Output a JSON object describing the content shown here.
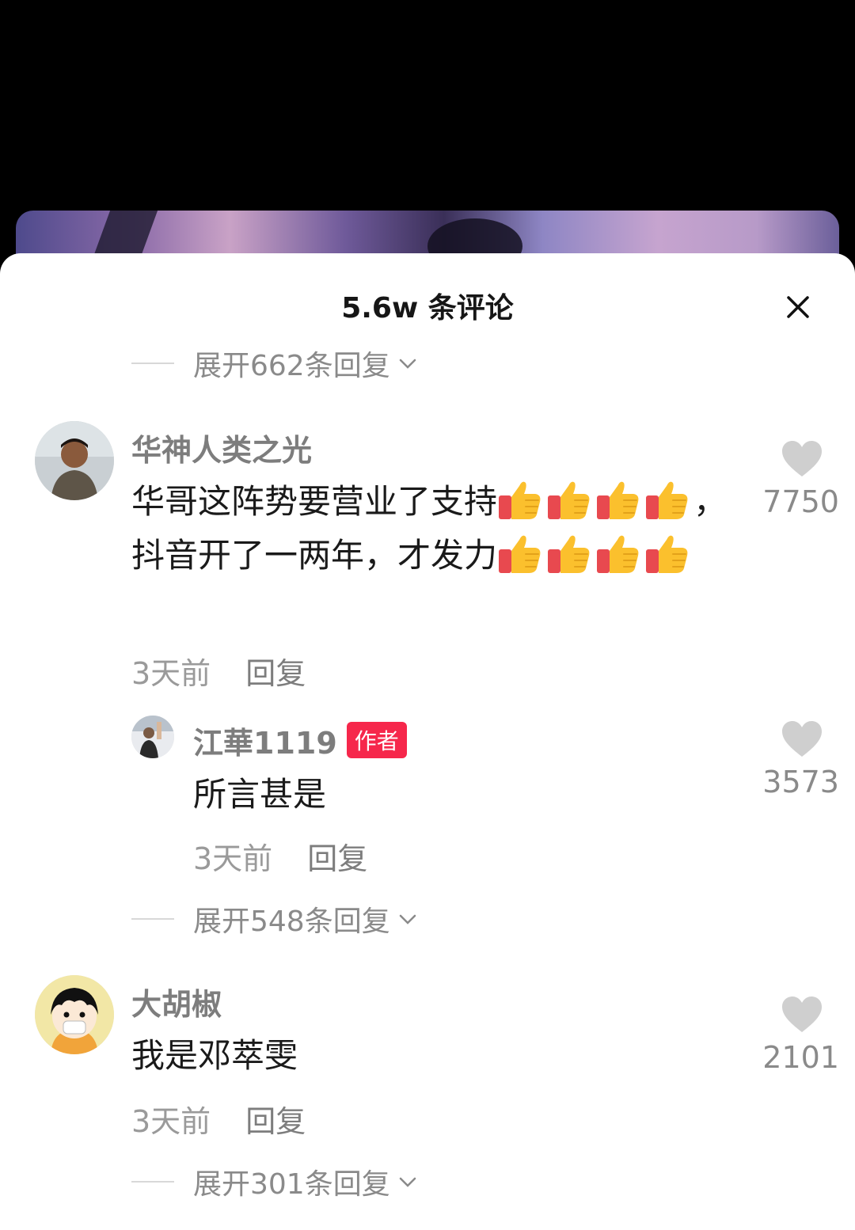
{
  "header": {
    "title": "5.6w 条评论"
  },
  "icons": {
    "close": "close-icon",
    "like": "heart-icon",
    "expand": "chevron-down-icon",
    "emoji": "thumbs-up-emoji"
  },
  "colors": {
    "author_badge": "#f6274b",
    "like_heart": "#cfcfcf"
  },
  "top_expand": {
    "label": "展开662条回复"
  },
  "comments": [
    {
      "username": "华神人类之光",
      "text_parts": [
        "华哥这阵势要营业了支持",
        "，抖音开了一两年，才发力"
      ],
      "thumbs_after_part1": 4,
      "thumbs_after_part2": 4,
      "time": "3天前",
      "reply_label": "回复",
      "likes": "7750",
      "reply": {
        "username": "江華1119",
        "badge": "作者",
        "text": "所言甚是",
        "time": "3天前",
        "reply_label": "回复",
        "likes": "3573"
      },
      "expand_label": "展开548条回复"
    },
    {
      "username": "大胡椒",
      "text": "我是邓萃雯",
      "time": "3天前",
      "reply_label": "回复",
      "likes": "2101",
      "expand_label": "展开301条回复"
    }
  ]
}
